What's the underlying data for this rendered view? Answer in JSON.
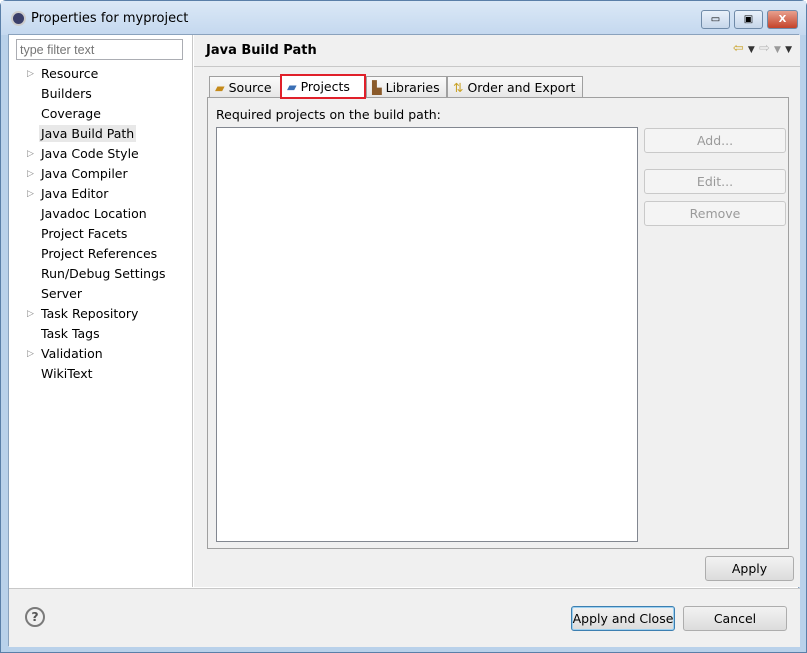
{
  "window": {
    "title": "Properties for myproject",
    "minimize": "▭",
    "maximize": "▣",
    "close": "X"
  },
  "filter": {
    "placeholder": "type filter text"
  },
  "tree": [
    {
      "label": "Resource",
      "expandable": true
    },
    {
      "label": "Builders",
      "expandable": false
    },
    {
      "label": "Coverage",
      "expandable": false
    },
    {
      "label": "Java Build Path",
      "expandable": false,
      "selected": true
    },
    {
      "label": "Java Code Style",
      "expandable": true
    },
    {
      "label": "Java Compiler",
      "expandable": true
    },
    {
      "label": "Java Editor",
      "expandable": true
    },
    {
      "label": "Javadoc Location",
      "expandable": false
    },
    {
      "label": "Project Facets",
      "expandable": false
    },
    {
      "label": "Project References",
      "expandable": false
    },
    {
      "label": "Run/Debug Settings",
      "expandable": false
    },
    {
      "label": "Server",
      "expandable": false
    },
    {
      "label": "Task Repository",
      "expandable": true
    },
    {
      "label": "Task Tags",
      "expandable": false
    },
    {
      "label": "Validation",
      "expandable": true
    },
    {
      "label": "WikiText",
      "expandable": false
    }
  ],
  "page": {
    "title": "Java Build Path"
  },
  "tabs": [
    {
      "label": "Source",
      "icon": "source-folder-icon"
    },
    {
      "label": "Projects",
      "icon": "projects-folder-icon",
      "active": true
    },
    {
      "label": "Libraries",
      "icon": "libraries-icon"
    },
    {
      "label": "Order and Export",
      "icon": "order-export-icon"
    }
  ],
  "projects": {
    "label": "Required projects on the build path:",
    "add": "Add...",
    "edit": "Edit...",
    "remove": "Remove"
  },
  "buttons": {
    "apply": "Apply",
    "apply_close": "Apply and Close",
    "cancel": "Cancel",
    "help": "?"
  }
}
